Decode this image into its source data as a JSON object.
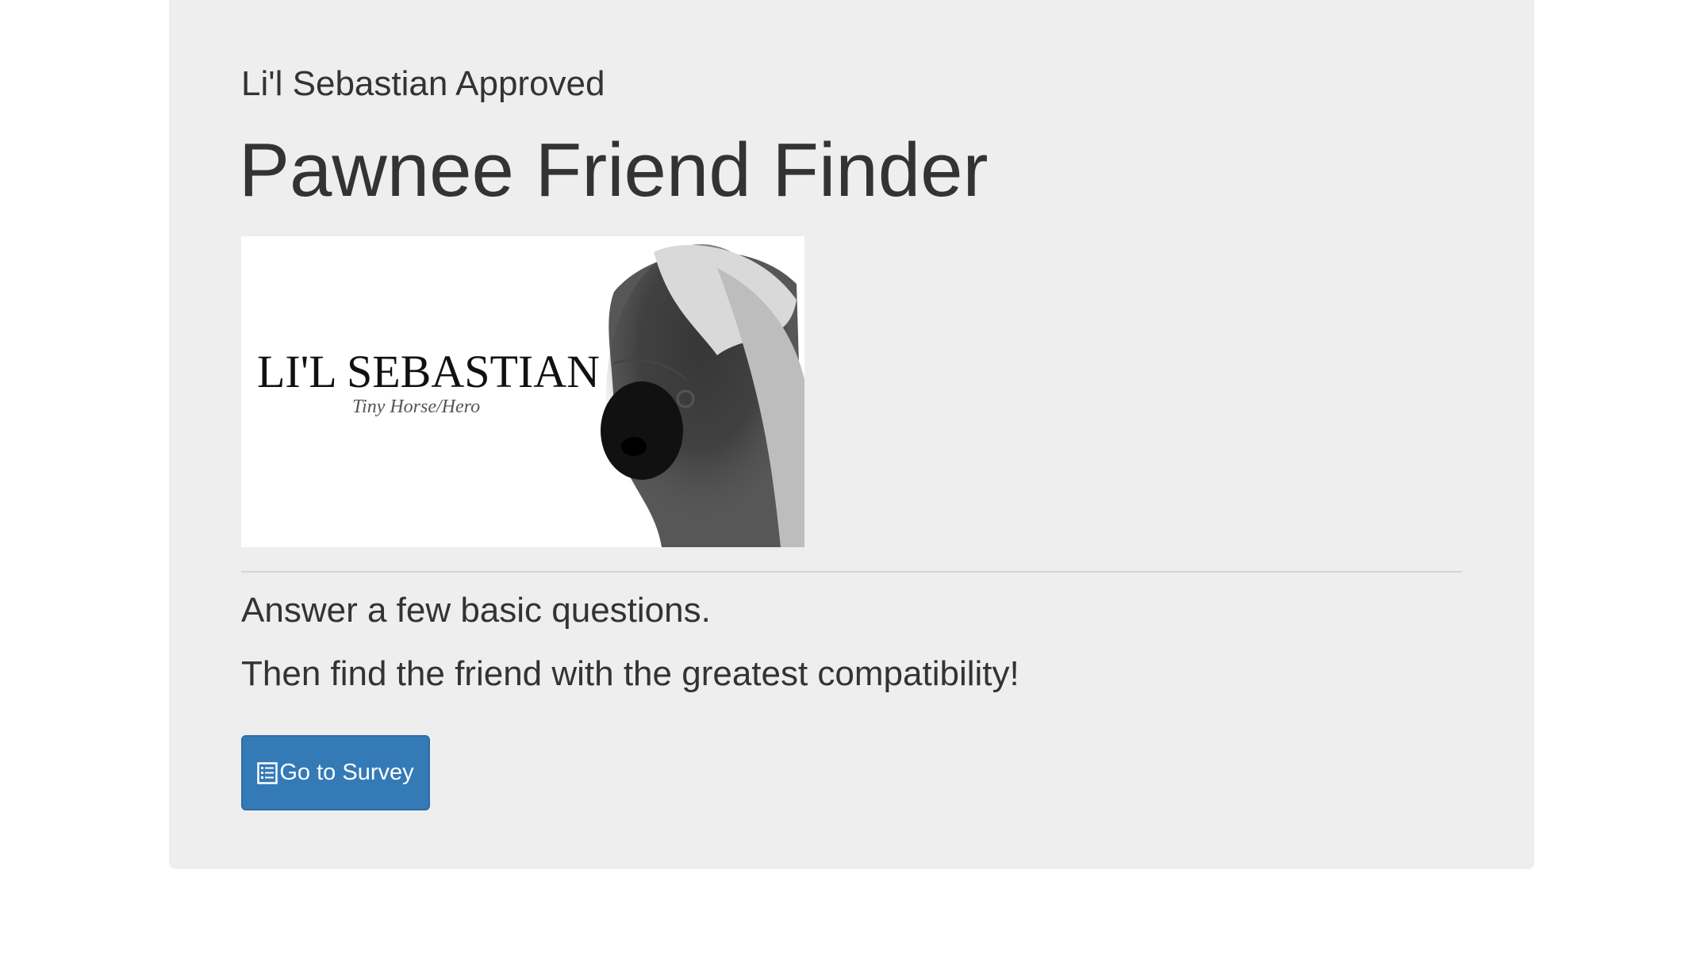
{
  "jumbotron": {
    "eyebrow": "Li'l Sebastian Approved",
    "title": "Pawnee Friend Finder"
  },
  "hero_image": {
    "logo_title": "LI'L SEBASTIAN",
    "logo_subtitle": "Tiny Horse/Hero"
  },
  "intro": {
    "line_1": "Answer a few basic questions.",
    "line_2": "Then find the friend with the greatest compatibility!"
  },
  "survey_button": {
    "icon": "list-alt-icon",
    "label": "Go to Survey",
    "color": "#337ab7"
  },
  "colors": {
    "jumbotron_bg": "#eeeeee",
    "text": "#333333",
    "primary": "#337ab7"
  }
}
